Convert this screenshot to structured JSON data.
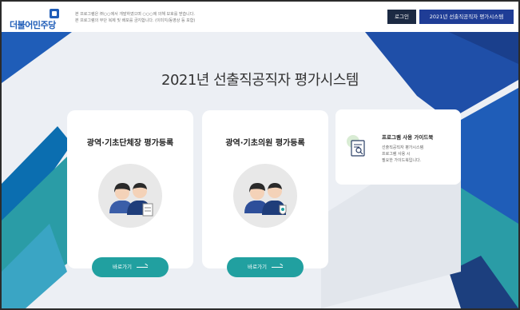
{
  "header": {
    "logo_text": "더불어민주당",
    "notice_lines": [
      "본 프로그램은 ㈜○○에서 개발하였으며 ○○○에 의해 보호를 받습니다.",
      "본 프로그램의 무단 복제 및 배포를 금지합니다. (이미지/동영상 등 포함)"
    ],
    "login_label": "로그인",
    "system_label": "2021년 선출직공직자 평가시스템"
  },
  "hero": {
    "title": "2021년 선출직공직자 평가시스템"
  },
  "cards": [
    {
      "title": "광역·기초단체장 평가등록",
      "button_label": "바로가기"
    },
    {
      "title": "광역·기초의원 평가등록",
      "button_label": "바로가기"
    }
  ],
  "guide": {
    "title": "프로그램 사용 가이드북",
    "desc_lines": [
      "선출직공직자 평가시스템",
      "프로그램 사용 시",
      "필요한 가이드북입니다."
    ]
  },
  "colors": {
    "brand_blue": "#1f5db8",
    "login_bg": "#1c2a43",
    "system_bg": "#1f3d96",
    "button_teal": "#21a0a0",
    "hero_bg": "#eceff4"
  }
}
